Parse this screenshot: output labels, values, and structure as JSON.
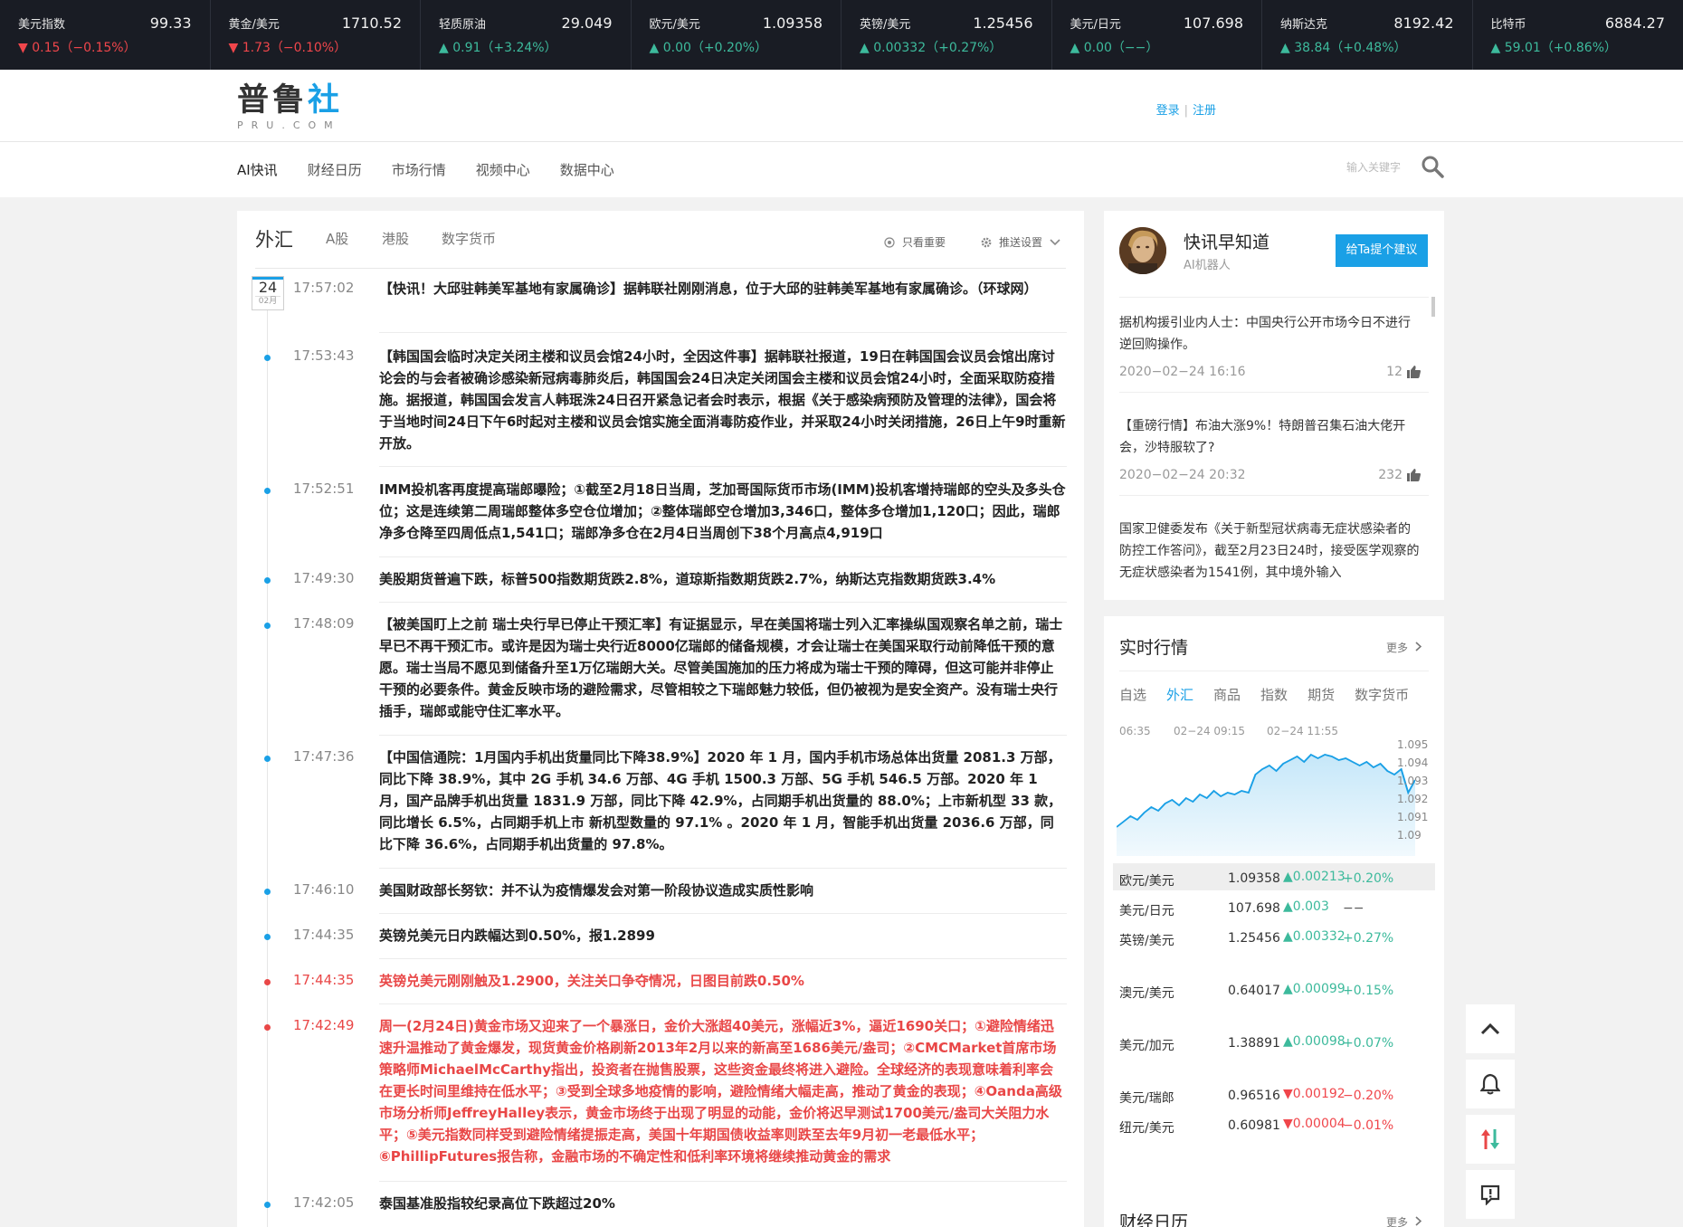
{
  "ticker": [
    {
      "name": "美元指数",
      "price": "99.33",
      "change": "0.15（−0.15%）",
      "dir": "down"
    },
    {
      "name": "黄金/美元",
      "price": "1710.52",
      "change": "1.73（−0.10%）",
      "dir": "down"
    },
    {
      "name": "轻质原油",
      "price": "29.049",
      "change": "0.91（+3.24%）",
      "dir": "up"
    },
    {
      "name": "欧元/美元",
      "price": "1.09358",
      "change": "0.00（+0.20%）",
      "dir": "up"
    },
    {
      "name": "英镑/美元",
      "price": "1.25456",
      "change": "0.00332（+0.27%）",
      "dir": "up"
    },
    {
      "name": "美元/日元",
      "price": "107.698",
      "change": "0.00（−−）",
      "dir": "up"
    },
    {
      "name": "纳斯达克",
      "price": "8192.42",
      "change": "38.84（+0.48%）",
      "dir": "up"
    },
    {
      "name": "比特币",
      "price": "6884.27",
      "change": "59.01（+0.86%）",
      "dir": "up"
    }
  ],
  "header": {
    "logo_main_a": "普鲁",
    "logo_main_b": "社",
    "logo_sub": "PRU.COM",
    "login": "登录",
    "sep": "|",
    "register": "注册"
  },
  "nav": {
    "items": [
      "AI快讯",
      "财经日历",
      "市场行情",
      "视频中心",
      "数据中心"
    ],
    "search_placeholder": "输入关键字"
  },
  "feed": {
    "tabs": [
      "外汇",
      "A股",
      "港股",
      "数字货币"
    ],
    "only_important": "只看重要",
    "push_settings": "推送设置",
    "date_day": "24",
    "date_month": "02月",
    "items": [
      {
        "time": "17:57:02",
        "red": false,
        "text": "【快讯！大邱驻韩美军基地有家属确诊】据韩联社刚刚消息，位于大邱的驻韩美军基地有家属确诊。（环球网）"
      },
      {
        "time": "17:53:43",
        "red": false,
        "text": "【韩国国会临时决定关闭主楼和议员会馆24小时，全因这件事】据韩联社报道，19日在韩国国会议员会馆出席讨论会的与会者被确诊感染新冠病毒肺炎后，韩国国会24日决定关闭国会主楼和议员会馆24小时，全面采取防疫措施。据报道，韩国国会发言人韩珉洙24日召开紧急记者会时表示，根据《关于感染病预防及管理的法律》，国会将于当地时间24日下午6时起对主楼和议员会馆实施全面消毒防疫作业，并采取24小时关闭措施，26日上午9时重新开放。"
      },
      {
        "time": "17:52:51",
        "red": false,
        "text": "IMM投机客再度提高瑞郎曝险；①截至2月18日当周，芝加哥国际货币市场(IMM)投机客增持瑞郎的空头及多头仓位；这是连续第二周瑞郎整体多空仓位增加；②整体瑞郎空仓增加3,346口，整体多仓增加1,120口；因此，瑞郎净多仓降至四周低点1,541口；瑞郎净多仓在2月4日当周创下38个月高点4,919口"
      },
      {
        "time": "17:49:30",
        "red": false,
        "text": "美股期货普遍下跌，标普500指数期货跌2.8%，道琼斯指数期货跌2.7%，纳斯达克指数期货跌3.4%"
      },
      {
        "time": "17:48:09",
        "red": false,
        "text": "【被美国盯上之前 瑞士央行早已停止干预汇率】有证据显示，早在美国将瑞士列入汇率操纵国观察名单之前，瑞士早已不再干预汇市。或许是因为瑞士央行近8000亿瑞郎的储备规模，才会让瑞士在美国采取行动前降低干预的意愿。瑞士当局不愿见到储备升至1万亿瑞朗大关。尽管美国施加的压力将成为瑞士干预的障碍，但这可能并非停止干预的必要条件。黄金反映市场的避险需求，尽管相较之下瑞郎魅力较低，但仍被视为是安全资产。没有瑞士央行插手，瑞郎或能守住汇率水平。"
      },
      {
        "time": "17:47:36",
        "red": false,
        "text": "【中国信通院：1月国内手机出货量同比下降38.9%】2020 年 1 月，国内手机市场总体出货量 2081.3 万部，同比下降 38.9%，其中 2G 手机 34.6 万部、4G 手机 1500.3 万部、5G 手机 546.5 万部。2020 年 1 月，国产品牌手机出货量 1831.9 万部，同比下降 42.9%，占同期手机出货量的 88.0%；上市新机型 33 款，同比增长 6.5%，占同期手机上市 新机型数量的 97.1% 。2020 年 1 月，智能手机出货量 2036.6 万部，同比下降 36.6%，占同期手机出货量的 97.8%。"
      },
      {
        "time": "17:46:10",
        "red": false,
        "text": "美国财政部长努钦：并不认为疫情爆发会对第一阶段协议造成实质性影响"
      },
      {
        "time": "17:44:35",
        "red": false,
        "text": "英镑兑美元日内跌幅达到0.50%，报1.2899"
      },
      {
        "time": "17:44:35",
        "red": true,
        "text": "英镑兑美元刚刚触及1.2900，关注关口争夺情况，日图目前跌0.50%"
      },
      {
        "time": "17:42:49",
        "red": true,
        "text": "周一(2月24日)黄金市场又迎来了一个暴涨日，金价大涨超40美元，涨幅近3%，逼近1690关口；①避险情绪迅速升温推动了黄金爆发，现货黄金价格刷新2013年2月以来的新高至1686美元/盎司；②CMCMarket首席市场策略师MichaelMcCarthy指出，投资者在抛售股票，这些资金最终将进入避险。全球经济的表现意味着利率会在更长时间里维持在低水平；③受到全球多地疫情的影响，避险情绪大幅走高，推动了黄金的表现；④Oanda高级市场分析师JeffreyHalley表示，黄金市场终于出现了明显的动能，金价将迟早测试1700美元/盎司大关阻力水平；⑤美元指数同样受到避险情绪提振走高，美国十年期国债收益率则跌至去年9月初一老最低水平；⑥PhillipFutures报告称，金融市场的不确定性和低利率环境将继续推动黄金的需求"
      },
      {
        "time": "17:42:05",
        "red": false,
        "text": "泰国基准股指较纪录高位下跌超过20%"
      }
    ]
  },
  "bot": {
    "name": "快讯早知道",
    "subtitle": "AI机器人",
    "suggest_button": "给Ta提个建议",
    "news": [
      {
        "text": "据机构援引业内人士：中国央行公开市场今日不进行逆回购操作。",
        "date": "2020−02−24 16:16",
        "count": "12"
      },
      {
        "text": "【重磅行情】布油大涨9%！特朗普召集石油大佬开会，沙特服软了?",
        "date": "2020−02−24 20:32",
        "count": "232"
      },
      {
        "text": "国家卫健委发布《关于新型冠状病毒无症状感染者的防控工作答问》，截至2月23日24时，接受医学观察的无症状感染者为1541例，其中境外输入",
        "date": "",
        "count": ""
      }
    ]
  },
  "market": {
    "title": "实时行情",
    "more": "更多",
    "tabs": [
      "自选",
      "外汇",
      "商品",
      "指数",
      "期货",
      "数字货币"
    ],
    "active_tab": "外汇",
    "quotes": [
      {
        "pair": "欧元/美元",
        "price": "1.09358",
        "change": "0.00213",
        "pct": "+0.20%",
        "dir": "up"
      },
      {
        "pair": "美元/日元",
        "price": "107.698",
        "change": "0.003",
        "pct": "−−",
        "dir": "up"
      },
      {
        "pair": "英镑/美元",
        "price": "1.25456",
        "change": "0.00332",
        "pct": "+0.27%",
        "dir": "up"
      },
      {
        "pair": "澳元/美元",
        "price": "0.64017",
        "change": "0.00099",
        "pct": "+0.15%",
        "dir": "up"
      },
      {
        "pair": "美元/加元",
        "price": "1.38891",
        "change": "0.00098",
        "pct": "+0.07%",
        "dir": "up"
      },
      {
        "pair": "美元/瑞郎",
        "price": "0.96516",
        "change": "0.00192",
        "pct": "−0.20%",
        "dir": "down"
      },
      {
        "pair": "纽元/美元",
        "price": "0.60981",
        "change": "0.00004",
        "pct": "−0.01%",
        "dir": "down"
      }
    ]
  },
  "chart_data": {
    "type": "area",
    "x_ticks": [
      "06:35",
      "02−24 09:15",
      "02−24 11:55"
    ],
    "yticks": [
      "1.095",
      "1.094",
      "1.093",
      "1.092",
      "1.091",
      "1.09"
    ],
    "ylim": [
      1.09,
      1.095
    ],
    "values": [
      1.0906,
      1.0909,
      1.0912,
      1.091,
      1.0914,
      1.0917,
      1.0915,
      1.0919,
      1.0921,
      1.0918,
      1.0922,
      1.092,
      1.0924,
      1.0922,
      1.0926,
      1.0923,
      1.0925,
      1.0924,
      1.0926,
      1.0925,
      1.0935,
      1.0938,
      1.094,
      1.0937,
      1.0941,
      1.0943,
      1.0945,
      1.0942,
      1.0946,
      1.0944,
      1.0946,
      1.0945,
      1.0943,
      1.0944,
      1.0942,
      1.094,
      1.0942,
      1.0939,
      1.0941,
      1.0937,
      1.0935,
      1.0938,
      1.0925,
      1.0932
    ],
    "color": "#1aa0e6"
  },
  "calendar": {
    "title": "财经日历",
    "more": "更多"
  }
}
